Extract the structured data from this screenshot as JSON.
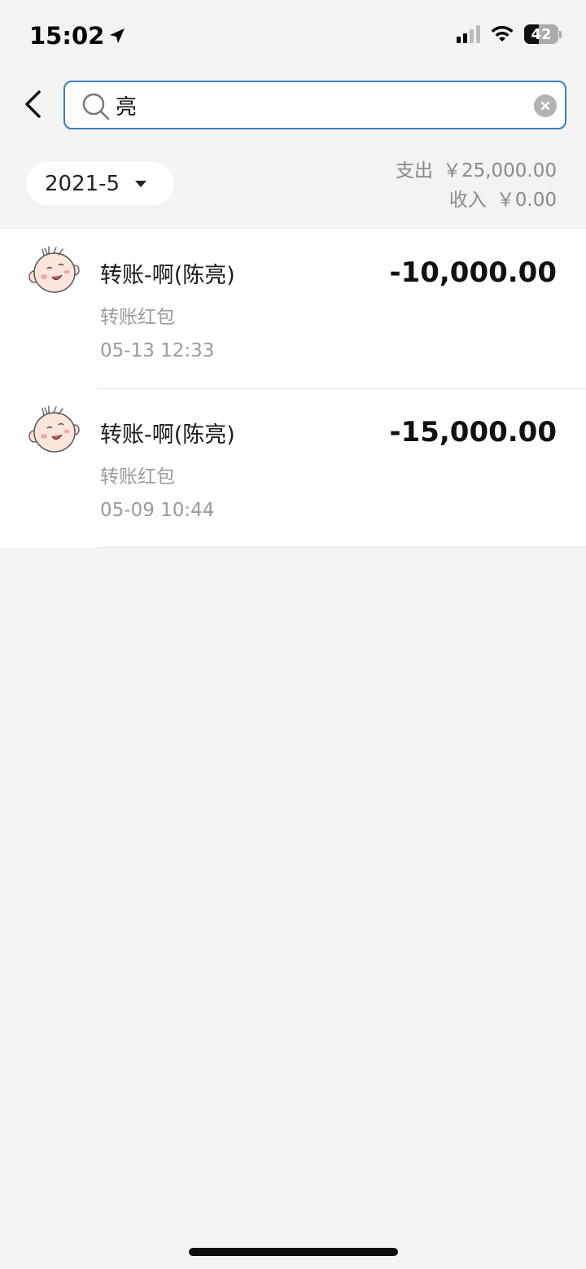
{
  "status_bar": {
    "time": "15:02",
    "battery": "42",
    "battery_level": 0.42,
    "icons": [
      "location-arrow-icon",
      "cellular-signal-icon",
      "wifi-icon",
      "battery-icon"
    ]
  },
  "search": {
    "value": "亮",
    "icons": [
      "back-chevron-icon",
      "search-icon",
      "clear-icon"
    ]
  },
  "filter": {
    "month": "2021-5"
  },
  "summary": {
    "expense_label": "支出",
    "expense_amount": "￥25,000.00",
    "income_label": "收入",
    "income_amount": "￥0.00"
  },
  "transactions": [
    {
      "title": "转账-啊(陈亮)",
      "category": "转账红包",
      "datetime": "05-13 12:33",
      "amount": "-10,000.00"
    },
    {
      "title": "转账-啊(陈亮)",
      "category": "转账红包",
      "datetime": "05-09 10:44",
      "amount": "-15,000.00"
    }
  ],
  "colors": {
    "accent": "#3a7ec9",
    "background": "#f3f3f3",
    "secondary_text": "#9b9b9b"
  }
}
